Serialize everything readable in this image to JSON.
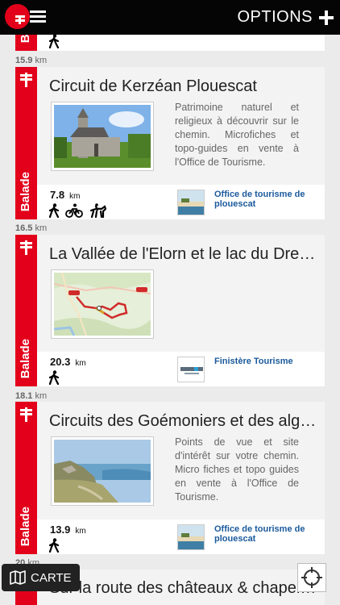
{
  "header": {
    "options_label": "OPTIONS"
  },
  "top_card": {
    "type_label": "Balade"
  },
  "distance_unit": "km",
  "items": [
    {
      "distance": "15.9",
      "type_label": "Balade",
      "title": "Circuit de Kerzéan Plouescat",
      "description": "Patrimoine naturel et religieux à découvrir sur le chemin. Microfiches et topo-guides en vente à l'Office de Tourisme.",
      "km_value": "7.8",
      "km_unit": "km",
      "activities": [
        "walking-icon",
        "cycling-icon",
        "horse-riding-icon"
      ],
      "provider": "Office de tourisme de plouescat"
    },
    {
      "distance": "16.5",
      "type_label": "Balade",
      "title": "La Vallée de l'Elorn et le lac du Drennec",
      "description": "",
      "km_value": "20.3",
      "km_unit": "km",
      "activities": [
        "walking-icon"
      ],
      "provider": "Finistère Tourisme"
    },
    {
      "distance": "18.1",
      "type_label": "Balade",
      "title": "Circuits des Goémoniers et des algues",
      "description": "Points de vue et site d'intérêt sur votre chemin. Micro fiches et topo guides en vente à l'Office de Tourisme.",
      "km_value": "13.9",
      "km_unit": "km",
      "activities": [
        "walking-icon"
      ],
      "provider": "Office de tourisme de plouescat"
    },
    {
      "distance": "20",
      "title": "Sur la route des châteaux & chapelles"
    }
  ],
  "carte_label": "CARTE",
  "colors": {
    "accent": "#e2001a",
    "header": "#050505",
    "provider_link": "#1b5a9c"
  }
}
